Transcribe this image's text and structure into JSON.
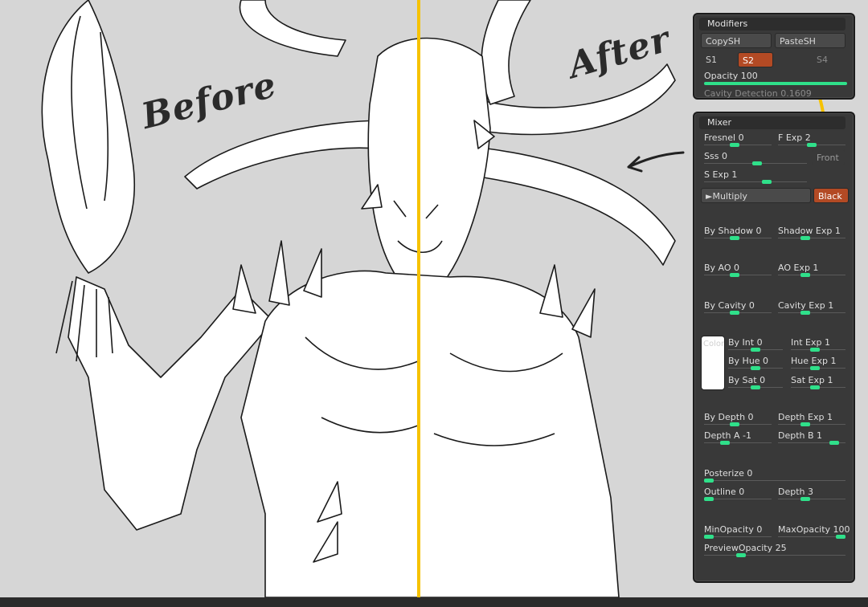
{
  "labels": {
    "before": "Before",
    "after": "After"
  },
  "accent": "#f6c200",
  "modifiers": {
    "title": "Modifiers",
    "copysh": "CopySH",
    "pastesh": "PasteSH",
    "s1": "S1",
    "s2": "S2",
    "s4": "S4",
    "opacity_label": "Opacity 100",
    "cavity_label": "Cavity Detection 0.1609"
  },
  "mixer": {
    "title": "Mixer",
    "fresnel": "Fresnel 0",
    "f_exp": "F Exp 2",
    "sss": "Sss 0",
    "front": "Front",
    "s_exp": "S Exp 1",
    "multiply": "►Multiply",
    "black": "Black",
    "by_shadow": "By Shadow 0",
    "shadow_exp": "Shadow Exp 1",
    "by_ao": "By AO 0",
    "ao_exp": "AO Exp 1",
    "by_cavity": "By Cavity 0",
    "cavity_exp": "Cavity Exp 1",
    "color": "Color",
    "by_int": "By Int 0",
    "int_exp": "Int Exp 1",
    "by_hue": "By Hue 0",
    "hue_exp": "Hue Exp 1",
    "by_sat": "By Sat 0",
    "sat_exp": "Sat Exp 1",
    "by_depth": "By Depth 0",
    "depth_exp": "Depth Exp 1",
    "depth_a": "Depth A -1",
    "depth_b": "Depth B 1",
    "posterize": "Posterize 0",
    "outline": "Outline 0",
    "depth": "Depth 3",
    "min_opacity": "MinOpacity 0",
    "max_opacity": "MaxOpacity 100",
    "preview_opacity": "PreviewOpacity 25"
  }
}
